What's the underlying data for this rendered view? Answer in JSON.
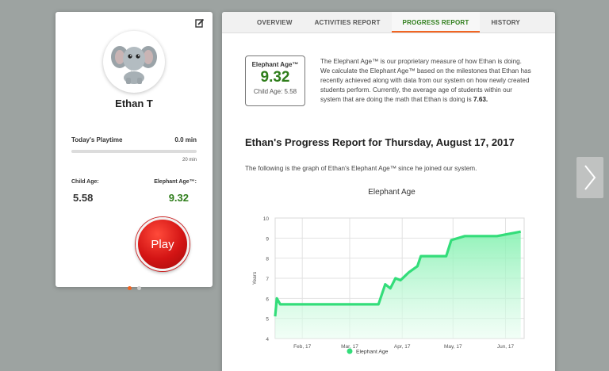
{
  "profile": {
    "name": "Ethan T",
    "playtime_label": "Today's Playtime",
    "playtime_value": "0.0 min",
    "playtime_max": "20 min",
    "playtime_progress": 0,
    "child_age_label": "Child Age:",
    "child_age_value": "5.58",
    "elephant_age_label": "Elephant Age™:",
    "elephant_age_value": "9.32",
    "play_label": "Play",
    "pager_count": 2,
    "pager_active": 0
  },
  "tabs": [
    {
      "label": "OVERVIEW",
      "active": false
    },
    {
      "label": "ACTIVITIES REPORT",
      "active": false
    },
    {
      "label": "PROGRESS REPORT",
      "active": true
    },
    {
      "label": "HISTORY",
      "active": false
    }
  ],
  "report": {
    "box_title": "Elephant Age™",
    "box_value": "9.32",
    "box_sub": "Child Age: 5.58",
    "description_text": "The Elephant Age™ is our proprietary measure of how Ethan is doing. We calculate the Elephant Age™ based on the milestones that Ethan has recently achieved along with data from our system on how newly created students perform. Currently, the average age of students within our system that are doing the math that Ethan is doing is ",
    "description_value": "7.63.",
    "title": "Ethan's Progress Report for Thursday, August 17, 2017",
    "subtitle": "The following is the graph of Ethan's Elephant Age™ since he joined our system."
  },
  "colors": {
    "accent_orange": "#f26522",
    "brand_green": "#2e7d1a",
    "line_green": "#33dd7a",
    "area_green": "#c8f7da"
  },
  "chart_data": {
    "type": "area",
    "title": "Elephant Age",
    "xlabel": "",
    "ylabel": "Years",
    "ylim": [
      4,
      10
    ],
    "y_ticks": [
      "4",
      "5",
      "6",
      "7",
      "8",
      "9",
      "10"
    ],
    "x_tick_labels": [
      "Feb, 17",
      "Mar, 17",
      "Apr, 17",
      "May, 17",
      "Jun, 17"
    ],
    "x_tick_dates": [
      "2017-02-15",
      "2017-03-15",
      "2017-04-15",
      "2017-05-15",
      "2017-06-15"
    ],
    "xlim": [
      "2017-01-30",
      "2017-06-26"
    ],
    "legend_position": "bottom",
    "grid": true,
    "series": [
      {
        "name": "Elephant Age",
        "color": "#33dd7a",
        "points": [
          [
            "2017-01-30",
            5.1
          ],
          [
            "2017-01-31",
            6.0
          ],
          [
            "2017-02-02",
            5.7
          ],
          [
            "2017-02-10",
            5.7
          ],
          [
            "2017-04-01",
            5.7
          ],
          [
            "2017-04-05",
            6.7
          ],
          [
            "2017-04-08",
            6.5
          ],
          [
            "2017-04-11",
            7.0
          ],
          [
            "2017-04-14",
            6.9
          ],
          [
            "2017-04-19",
            7.3
          ],
          [
            "2017-04-24",
            7.6
          ],
          [
            "2017-04-26",
            8.1
          ],
          [
            "2017-05-11",
            8.1
          ],
          [
            "2017-05-14",
            8.9
          ],
          [
            "2017-05-22",
            9.1
          ],
          [
            "2017-06-10",
            9.1
          ],
          [
            "2017-06-24",
            9.32
          ]
        ]
      }
    ]
  }
}
